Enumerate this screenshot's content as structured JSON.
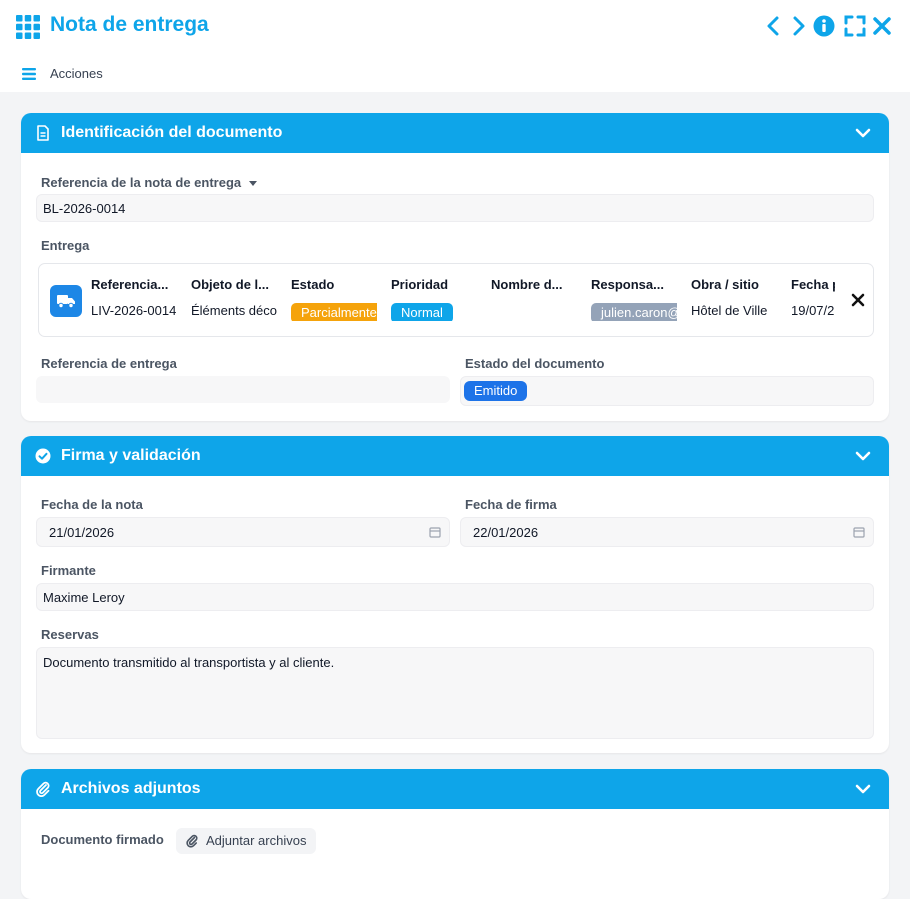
{
  "header": {
    "title": "Nota de entrega",
    "actions_label": "Acciones"
  },
  "identificacion": {
    "title": "Identificación del documento",
    "ref_label": "Referencia de la nota de entrega",
    "ref_value": "BL-2026-0014",
    "entrega_label": "Entrega",
    "entrega_columns": [
      "Referencia...",
      "Objeto de l...",
      "Estado",
      "Prioridad",
      "Nombre d...",
      "Responsa...",
      "Obra / sitio",
      "Fecha p"
    ],
    "entrega_row": {
      "referencia": "LIV-2026-0014",
      "objeto": "Éléments décoratifs",
      "estado": "Parcialmente",
      "prioridad": "Normal",
      "nombre": "",
      "responsable": "julien.caron@",
      "obra": "Hôtel de Ville",
      "fecha": "19/07/2"
    },
    "ref_entrega_label": "Referencia de entrega",
    "ref_entrega_value": "",
    "estado_doc_label": "Estado del documento",
    "estado_doc_value": "Emitido"
  },
  "firma": {
    "title": "Firma y validación",
    "fecha_nota_label": "Fecha de la nota",
    "fecha_nota_value": "21/01/2026",
    "fecha_firma_label": "Fecha de firma",
    "fecha_firma_value": "22/01/2026",
    "firmante_label": "Firmante",
    "firmante_value": "Maxime Leroy",
    "reservas_label": "Reservas",
    "reservas_value": "Documento transmitido al transportista y al cliente."
  },
  "archivos": {
    "title": "Archivos adjuntos",
    "doc_firmado_label": "Documento firmado",
    "attach_label": "Adjuntar archivos"
  },
  "colors": {
    "accent": "#0ea5e9",
    "estado_badge": "#f5a30b",
    "prioridad_badge": "#0ea5e9",
    "responsable_badge": "#94a3b8",
    "emitido_badge": "#1d73e8"
  }
}
